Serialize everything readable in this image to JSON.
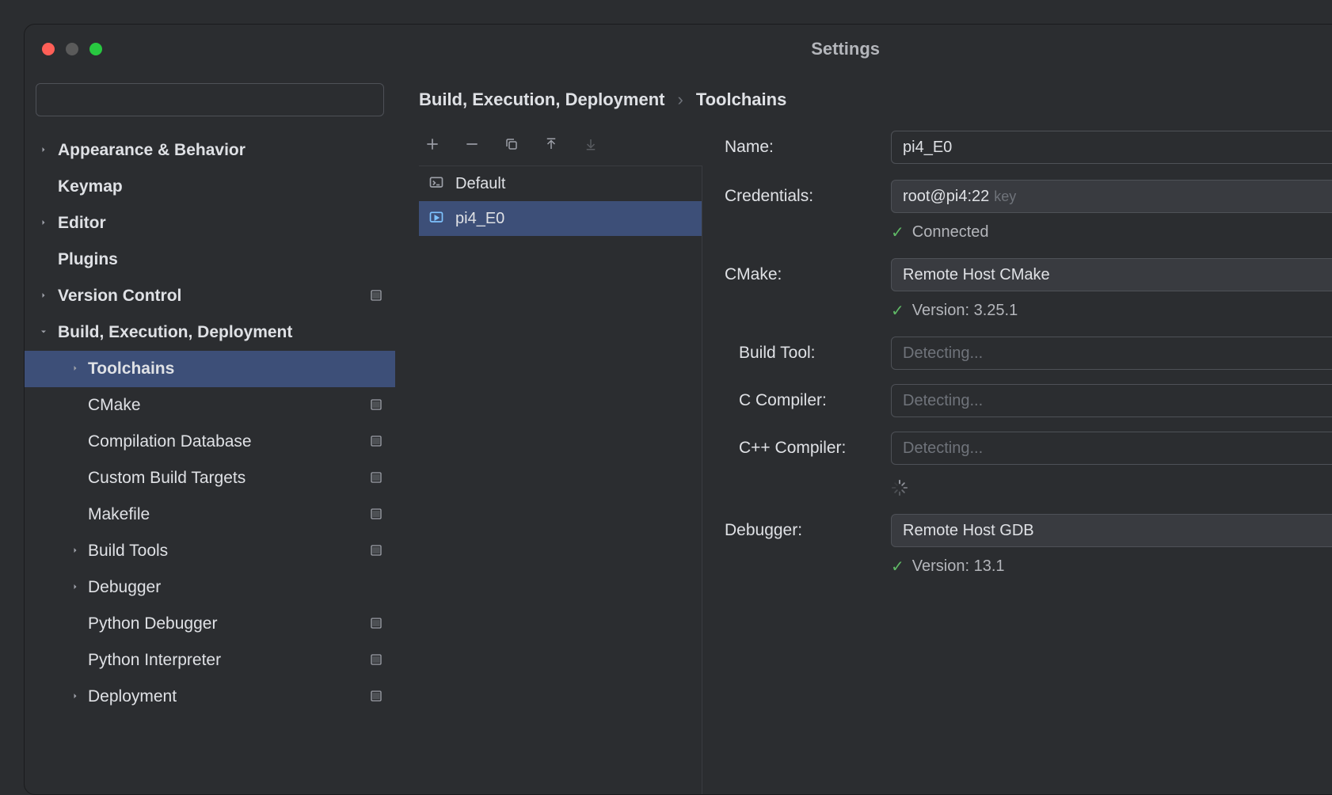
{
  "window": {
    "title": "Settings"
  },
  "sidebar": {
    "search_placeholder": "",
    "items": [
      {
        "label": "Appearance & Behavior",
        "expandable": true,
        "chev": "right",
        "level": 1,
        "winbadge": false
      },
      {
        "label": "Keymap",
        "expandable": false,
        "level": 1,
        "winbadge": false
      },
      {
        "label": "Editor",
        "expandable": true,
        "chev": "right",
        "level": 1,
        "winbadge": false
      },
      {
        "label": "Plugins",
        "expandable": false,
        "level": 1,
        "winbadge": false
      },
      {
        "label": "Version Control",
        "expandable": true,
        "chev": "right",
        "level": 1,
        "winbadge": true
      },
      {
        "label": "Build, Execution, Deployment",
        "expandable": true,
        "chev": "down",
        "level": 1,
        "winbadge": false
      },
      {
        "label": "Toolchains",
        "expandable": true,
        "chev": "right",
        "level": 2,
        "bold": true,
        "selected": true,
        "winbadge": false
      },
      {
        "label": "CMake",
        "expandable": false,
        "level": 2,
        "winbadge": true
      },
      {
        "label": "Compilation Database",
        "expandable": false,
        "level": 2,
        "winbadge": true
      },
      {
        "label": "Custom Build Targets",
        "expandable": false,
        "level": 2,
        "winbadge": true
      },
      {
        "label": "Makefile",
        "expandable": false,
        "level": 2,
        "winbadge": true
      },
      {
        "label": "Build Tools",
        "expandable": true,
        "chev": "right",
        "level": 2,
        "winbadge": true
      },
      {
        "label": "Debugger",
        "expandable": true,
        "chev": "right",
        "level": 2,
        "winbadge": false
      },
      {
        "label": "Python Debugger",
        "expandable": false,
        "level": 2,
        "winbadge": true
      },
      {
        "label": "Python Interpreter",
        "expandable": false,
        "level": 2,
        "winbadge": true
      },
      {
        "label": "Deployment",
        "expandable": true,
        "chev": "right",
        "level": 2,
        "winbadge": true
      }
    ]
  },
  "breadcrumb": {
    "parent": "Build, Execution, Deployment",
    "sep": "›",
    "current": "Toolchains"
  },
  "tc_list": {
    "items": [
      {
        "label": "Default",
        "icon": "terminal"
      },
      {
        "label": "pi4_E0",
        "icon": "remote",
        "selected": true
      }
    ]
  },
  "form": {
    "name_label": "Name:",
    "name_value": "pi4_E0",
    "credentials_label": "Credentials:",
    "credentials_value": "root@pi4:22",
    "credentials_suffix": "key",
    "connected_text": "Connected",
    "cmake_label": "CMake:",
    "cmake_value": "Remote Host CMake",
    "cmake_version": "Version: 3.25.1",
    "build_tool_label": "Build Tool:",
    "build_tool_placeholder": "Detecting...",
    "c_compiler_label": "C Compiler:",
    "c_compiler_placeholder": "Detecting...",
    "cpp_compiler_label": "C++ Compiler:",
    "cpp_compiler_placeholder": "Detecting...",
    "debugger_label": "Debugger:",
    "debugger_value": "Remote Host GDB",
    "debugger_version": "Version: 13.1"
  }
}
